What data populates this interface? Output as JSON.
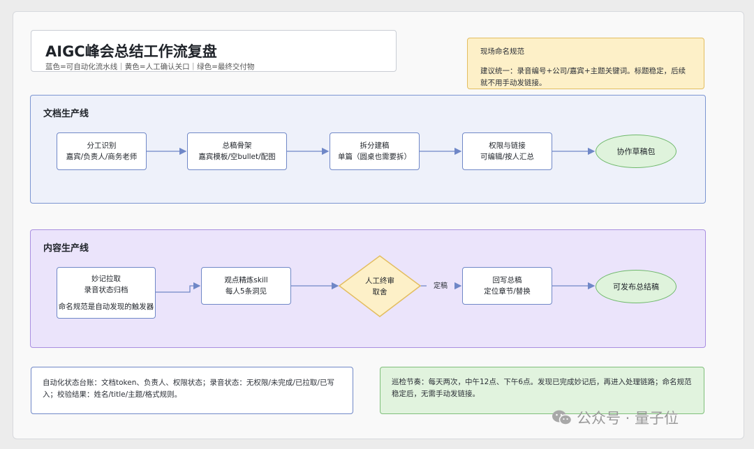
{
  "title": "AIGC峰会总结工作流复盘",
  "subtitle": "蓝色=可自动化流水线｜黄色=人工确认关口｜绿色=最终交付物",
  "naming_note": {
    "heading": "现场命名规范",
    "body": "建议统一：录音编号+公司/嘉宾+主题关键词。标题稳定，后续就不用手动发链接。"
  },
  "doc_lane": {
    "title": "文档生产线",
    "nodes": [
      {
        "line1": "分工识别",
        "line2": "嘉宾/负责人/商务老师"
      },
      {
        "line1": "总稿骨架",
        "line2": "嘉宾模板/空bullet/配图"
      },
      {
        "line1": "拆分建稿",
        "line2": "单篇（圆桌也需要拆）"
      },
      {
        "line1": "权限与链接",
        "line2": "可编辑/按人汇总"
      }
    ],
    "output": "协作草稿包"
  },
  "content_lane": {
    "title": "内容生产线",
    "node1": {
      "line1": "妙记拉取",
      "line2": "录音状态归档",
      "line3": "命名规范是自动发现的触发器"
    },
    "node2": {
      "line1": "观点精炼skill",
      "line2": "每人5条洞见"
    },
    "decision": {
      "line1": "人工终审",
      "line2": "取舍"
    },
    "edge_label": "定稿",
    "node4": {
      "line1": "回写总稿",
      "line2": "定位章节/替换"
    },
    "output": "可发布总结稿"
  },
  "status_note": "自动化状态台账：文档token、负责人、权限状态；录音状态：无权限/未完成/已拉取/已写入；校验结果：姓名/title/主题/格式规则。",
  "schedule_note": "巡检节奏：每天两次，中午12点、下午6点。发现已完成妙记后，再进入处理链路；命名规范稳定后，无需手动发链接。",
  "watermark": "公众号 · 量子位",
  "colors": {
    "blue": "#6f87c7",
    "yellow": "#e3bd60",
    "green": "#6fb86b",
    "purple": "#a98ee0"
  }
}
